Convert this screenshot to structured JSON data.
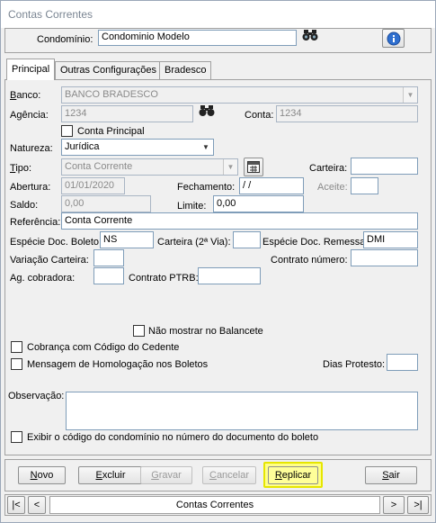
{
  "window": {
    "title": "Contas Correntes"
  },
  "header": {
    "condominio_label": "Condomínio:",
    "condominio_value": "Condominio Modelo"
  },
  "tabs": [
    {
      "label": "Principal"
    },
    {
      "label": "Outras Configurações"
    },
    {
      "label": "Bradesco"
    }
  ],
  "form": {
    "banco_label": "Banco:",
    "banco_value": "BANCO BRADESCO",
    "agencia_label": "Agência:",
    "agencia_value": "1234",
    "conta_label": "Conta:",
    "conta_value": "1234",
    "conta_principal_label": "Conta Principal",
    "natureza_label": "Natureza:",
    "natureza_value": "Jurídica",
    "tipo_label": "Tipo:",
    "tipo_value": "Conta Corrente",
    "carteira_label": "Carteira:",
    "carteira_value": "",
    "abertura_label": "Abertura:",
    "abertura_value": "01/01/2020",
    "fechamento_label": "Fechamento:",
    "fechamento_value": " / /",
    "aceite_label": "Aceite:",
    "aceite_value": "",
    "saldo_label": "Saldo:",
    "saldo_value": "0,00",
    "limite_label": "Limite:",
    "limite_value": "0,00",
    "referencia_label": "Referência:",
    "referencia_value": "Conta Corrente",
    "especie_boleto_label": "Espécie Doc. Boleto:",
    "especie_boleto_value": "NS",
    "carteira2_label": "Carteira (2ª Via):",
    "carteira2_value": "",
    "especie_remessa_label": "Espécie Doc. Remessa:",
    "especie_remessa_value": "DMI",
    "variacao_label": "Variação Carteira:",
    "variacao_value": "",
    "contrato_numero_label": "Contrato número:",
    "contrato_numero_value": "",
    "ag_cobradora_label": "Ag. cobradora:",
    "ag_cobradora_value": "",
    "contrato_ptrb_label": "Contrato PTRB:",
    "contrato_ptrb_value": "",
    "nao_mostrar_label": "Não mostrar no Balancete",
    "cobranca_label": "Cobrança com Código do Cedente",
    "mensagem_label": "Mensagem de Homologação nos Boletos",
    "dias_protesto_label": "Dias Protesto:",
    "dias_protesto_value": "",
    "observacao_label": "Observação:",
    "observacao_value": "",
    "exibir_label": "Exibir o código do condomínio no número do documento do boleto"
  },
  "buttons": {
    "novo": "Novo",
    "excluir": "Excluir",
    "gravar": "Gravar",
    "cancelar": "Cancelar",
    "replicar": "Replicar",
    "sair": "Sair"
  },
  "navigator": {
    "first": "|<",
    "prev": "<",
    "label": "Contas Correntes",
    "next": ">",
    "last": ">|"
  },
  "icons": {
    "binoculars": "binoculars-icon",
    "info": "info-icon",
    "calendar": "calendar-icon"
  }
}
